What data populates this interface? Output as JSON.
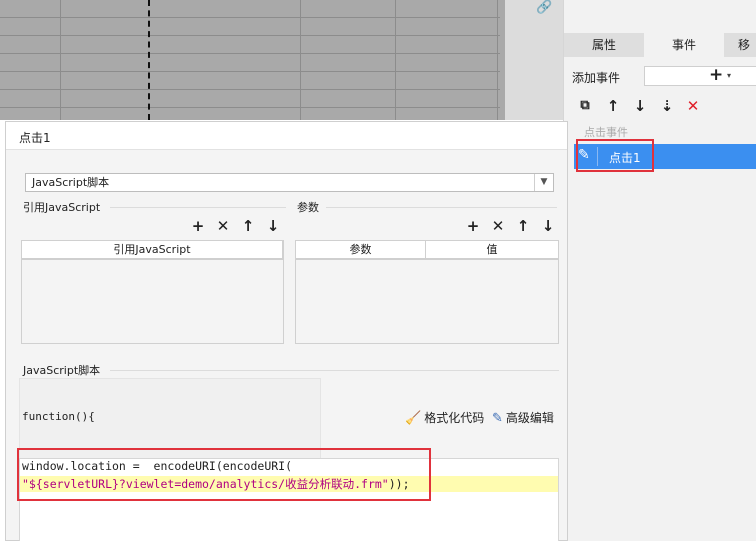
{
  "right_panel": {
    "tabs": [
      {
        "label": "属性"
      },
      {
        "label": "事件"
      },
      {
        "label": "移"
      }
    ],
    "add_event_label": "添加事件",
    "add_plus": "+",
    "add_caret": "▾",
    "event_group": "点击事件",
    "event_item": "点击1"
  },
  "dialog": {
    "title": "点击1",
    "script_type": "JavaScript脚本",
    "ref_js_section": "引用JavaScript",
    "param_section": "参数",
    "ref_js_column": "引用JavaScript",
    "param_columns": [
      "参数",
      "值"
    ],
    "script_section": "JavaScript脚本",
    "function_header": "function(){",
    "format_code": "格式化代码",
    "advanced_edit": "高级编辑",
    "code_line1": "window.location =  encodeURI(encodeURI(",
    "code_line2_str": "\"${servletURL}?viewlet=demo/analytics/收益分析联动.frm\"",
    "code_line2_end": "));"
  },
  "colors": {
    "selection_blue": "#3b8ff0",
    "highlight_red": "#e0323c",
    "code_highlight": "#fffcb0",
    "string_color": "#b00082"
  }
}
